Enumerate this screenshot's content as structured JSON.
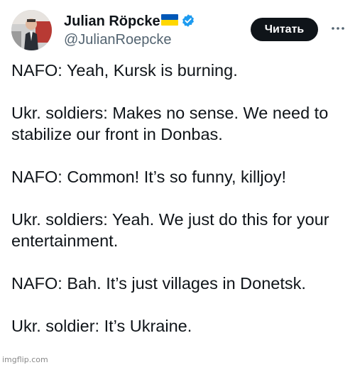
{
  "author": {
    "display_name": "Julian Röpcke",
    "handle": "@JulianRoepcke",
    "flag_icon": "ukraine-flag-icon",
    "verified_icon": "verified-badge-icon",
    "verified_color": "#1d9bf0"
  },
  "actions": {
    "subscribe_label": "Читать",
    "more_icon": "more-horizontal-icon"
  },
  "tweet": {
    "paragraphs": [
      "NAFO: Yeah, Kursk is burning.",
      "Ukr. soldiers: Makes no sense. We need to stabilize our front in Donbas.",
      "NAFO: Common! It’s so funny, killjoy!",
      "Ukr. soldiers: Yeah. We just do this for your entertainment.",
      "NAFO: Bah. It’s just villages in Donetsk.",
      "Ukr. soldier: It’s Ukraine."
    ]
  },
  "watermark": "imgflip.com",
  "colors": {
    "text": "#0f1419",
    "secondary": "#536471",
    "button_bg": "#0f1419",
    "flag_blue": "#0057b7",
    "flag_yellow": "#ffd700"
  }
}
